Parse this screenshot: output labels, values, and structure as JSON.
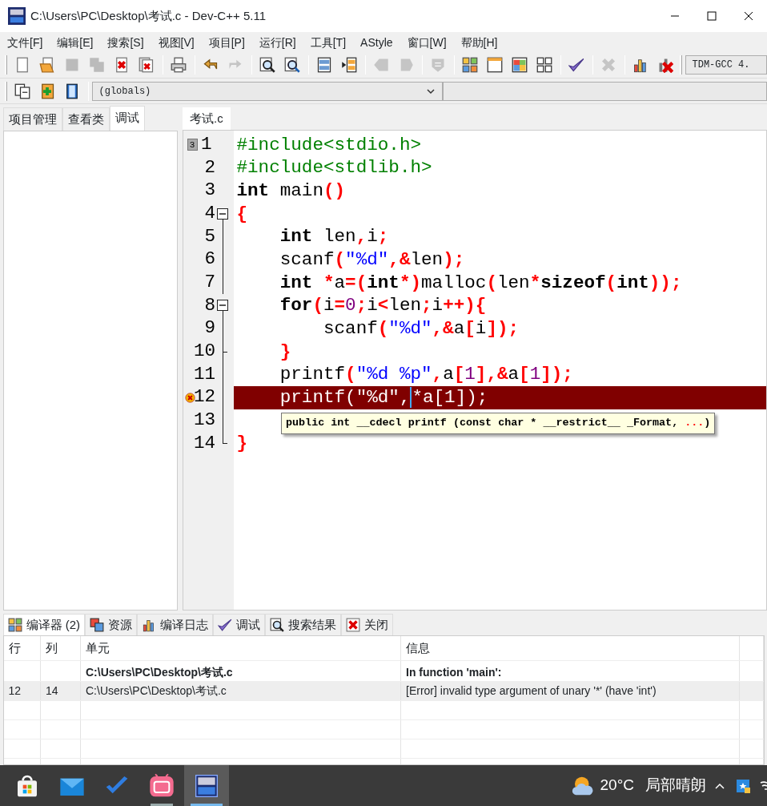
{
  "window": {
    "title": "C:\\Users\\PC\\Desktop\\考试.c - Dev-C++ 5.11"
  },
  "menu": [
    "文件[F]",
    "编辑[E]",
    "搜索[S]",
    "视图[V]",
    "项目[P]",
    "运行[R]",
    "工具[T]",
    "AStyle",
    "窗口[W]",
    "帮助[H]"
  ],
  "toolbar": [
    [
      {
        "kind": "new",
        "disabled": false
      },
      {
        "kind": "open",
        "disabled": false
      },
      {
        "kind": "save",
        "disabled": true
      },
      {
        "kind": "saveall",
        "disabled": true
      },
      {
        "kind": "close",
        "disabled": false
      },
      {
        "kind": "closeall",
        "disabled": false
      }
    ],
    [
      {
        "kind": "print",
        "disabled": false
      }
    ],
    [
      {
        "kind": "undo",
        "disabled": false
      },
      {
        "kind": "redo",
        "disabled": true
      }
    ],
    [
      {
        "kind": "find",
        "disabled": false
      },
      {
        "kind": "replace",
        "disabled": false
      }
    ],
    [
      {
        "kind": "split",
        "disabled": false
      },
      {
        "kind": "panel",
        "disabled": false
      }
    ],
    [
      {
        "kind": "tagleft",
        "disabled": true
      },
      {
        "kind": "tagright",
        "disabled": true
      }
    ],
    [
      {
        "kind": "shield",
        "disabled": true
      }
    ],
    [
      {
        "kind": "squares",
        "disabled": false
      },
      {
        "kind": "window",
        "disabled": false
      },
      {
        "kind": "tiles",
        "disabled": false
      },
      {
        "kind": "grid",
        "disabled": false
      }
    ],
    [
      {
        "kind": "check",
        "disabled": false
      }
    ],
    [
      {
        "kind": "cross",
        "disabled": true
      }
    ],
    [
      {
        "kind": "chart",
        "disabled": false
      },
      {
        "kind": "chartx",
        "disabled": false
      }
    ]
  ],
  "compiler_select": {
    "value": "TDM-GCC 4."
  },
  "toolbar2": [
    {
      "kind": "copy",
      "disabled": false
    },
    {
      "kind": "add",
      "disabled": false
    },
    {
      "kind": "book",
      "disabled": false
    }
  ],
  "scope_select": {
    "value": "(globals)"
  },
  "left_tabs": [
    {
      "label": "项目管理",
      "selected": false
    },
    {
      "label": "查看类",
      "selected": false
    },
    {
      "label": "调试",
      "selected": true
    }
  ],
  "editor_tabs": [
    {
      "label": "考试.c",
      "selected": true
    }
  ],
  "code": [
    {
      "number": "1",
      "bookmark": "3",
      "kind": "plain",
      "error": false,
      "tokens": [
        {
          "kind": "pre",
          "text": "#include<stdio.h>"
        }
      ]
    },
    {
      "number": "2",
      "kind": "plain",
      "error": false,
      "tokens": [
        {
          "kind": "pre",
          "text": "#include<stdlib.h>"
        }
      ]
    },
    {
      "number": "3",
      "kind": "plain",
      "error": false,
      "tokens": [
        {
          "kind": "kw",
          "text": "int"
        },
        {
          "kind": "id",
          "text": " main"
        },
        {
          "kind": "op",
          "text": "()"
        }
      ]
    },
    {
      "number": "4",
      "kind": "open",
      "error": false,
      "tokens": [
        {
          "kind": "op",
          "text": "{"
        }
      ]
    },
    {
      "number": "5",
      "kind": "inner",
      "error": false,
      "tokens": [
        {
          "kind": "kw",
          "text": "    int"
        },
        {
          "kind": "id",
          "text": " len"
        },
        {
          "kind": "op",
          "text": ","
        },
        {
          "kind": "id",
          "text": "i"
        },
        {
          "kind": "op",
          "text": ";"
        }
      ]
    },
    {
      "number": "6",
      "kind": "inner",
      "error": false,
      "tokens": [
        {
          "kind": "id",
          "text": "    scanf"
        },
        {
          "kind": "op",
          "text": "("
        },
        {
          "kind": "str",
          "text": "\"%d\""
        },
        {
          "kind": "op",
          "text": ",&"
        },
        {
          "kind": "id",
          "text": "len"
        },
        {
          "kind": "op",
          "text": ");"
        }
      ]
    },
    {
      "number": "7",
      "kind": "inner",
      "error": false,
      "tokens": [
        {
          "kind": "kw",
          "text": "    int "
        },
        {
          "kind": "op",
          "text": "*"
        },
        {
          "kind": "id",
          "text": "a"
        },
        {
          "kind": "op",
          "text": "=("
        },
        {
          "kind": "kw",
          "text": "int"
        },
        {
          "kind": "op",
          "text": "*)"
        },
        {
          "kind": "id",
          "text": "malloc"
        },
        {
          "kind": "op",
          "text": "("
        },
        {
          "kind": "id",
          "text": "len"
        },
        {
          "kind": "op",
          "text": "*"
        },
        {
          "kind": "kw",
          "text": "sizeof"
        },
        {
          "kind": "op",
          "text": "("
        },
        {
          "kind": "kw",
          "text": "int"
        },
        {
          "kind": "op",
          "text": "));"
        }
      ]
    },
    {
      "number": "8",
      "kind": "open",
      "error": false,
      "tokens": [
        {
          "kind": "kw",
          "text": "    for"
        },
        {
          "kind": "op",
          "text": "("
        },
        {
          "kind": "id",
          "text": "i"
        },
        {
          "kind": "op",
          "text": "="
        },
        {
          "kind": "num",
          "text": "0"
        },
        {
          "kind": "op",
          "text": ";"
        },
        {
          "kind": "id",
          "text": "i"
        },
        {
          "kind": "op",
          "text": "<"
        },
        {
          "kind": "id",
          "text": "len"
        },
        {
          "kind": "op",
          "text": ";"
        },
        {
          "kind": "id",
          "text": "i"
        },
        {
          "kind": "op",
          "text": "++){"
        }
      ]
    },
    {
      "number": "9",
      "kind": "inner",
      "error": false,
      "tokens": [
        {
          "kind": "id",
          "text": "        scanf"
        },
        {
          "kind": "op",
          "text": "("
        },
        {
          "kind": "str",
          "text": "\"%d\""
        },
        {
          "kind": "op",
          "text": ",&"
        },
        {
          "kind": "id",
          "text": "a"
        },
        {
          "kind": "op",
          "text": "["
        },
        {
          "kind": "id",
          "text": "i"
        },
        {
          "kind": "op",
          "text": "]);"
        }
      ]
    },
    {
      "number": "10",
      "kind": "close",
      "error": false,
      "tokens": [
        {
          "kind": "op",
          "text": "    }"
        }
      ]
    },
    {
      "number": "11",
      "kind": "inner",
      "error": false,
      "tokens": [
        {
          "kind": "id",
          "text": "    printf"
        },
        {
          "kind": "op",
          "text": "("
        },
        {
          "kind": "str",
          "text": "\"%d %p\""
        },
        {
          "kind": "op",
          "text": ","
        },
        {
          "kind": "id",
          "text": "a"
        },
        {
          "kind": "op",
          "text": "["
        },
        {
          "kind": "num",
          "text": "1"
        },
        {
          "kind": "op",
          "text": "],&"
        },
        {
          "kind": "id",
          "text": "a"
        },
        {
          "kind": "op",
          "text": "["
        },
        {
          "kind": "num",
          "text": "1"
        },
        {
          "kind": "op",
          "text": "]);"
        }
      ]
    },
    {
      "number": "12",
      "kind": "inner",
      "error": true,
      "tokens": [
        {
          "kind": "id",
          "text": "    printf(\"%d\","
        },
        {
          "kind": "id",
          "text": "*a[1]);",
          "caret": true
        }
      ]
    },
    {
      "number": "13",
      "kind": "inner",
      "error": false
    },
    {
      "number": "14",
      "kind": "last",
      "error": false,
      "tokens": [
        {
          "kind": "op",
          "text": "}"
        }
      ]
    }
  ],
  "calltip": [
    {
      "kind": "kw",
      "text": "public int __cdecl printf (const char * __restrict__ _Format, "
    },
    {
      "kind": "op",
      "text": "..."
    },
    {
      "kind": "kw",
      "text": ")"
    }
  ],
  "bottom_tabs": [
    {
      "kind": "squares",
      "label": "编译器 (2)",
      "selected": true
    },
    {
      "kind": "copies",
      "label": "资源",
      "selected": false
    },
    {
      "kind": "chart",
      "label": "编译日志",
      "selected": false
    },
    {
      "kind": "check",
      "label": "调试",
      "selected": false
    },
    {
      "kind": "find",
      "label": "搜索结果",
      "selected": false
    },
    {
      "kind": "closex",
      "label": "关闭",
      "selected": false
    }
  ],
  "messages": {
    "columns": [
      "行",
      "列",
      "单元",
      "信息"
    ],
    "rows": [
      {
        "kind": "context",
        "selected": false,
        "unit": "C:\\Users\\PC\\Desktop\\考试.c",
        "message": "In function 'main':"
      },
      {
        "kind": "error",
        "selected": true,
        "line": "12",
        "col": "14",
        "unit": "C:\\Users\\PC\\Desktop\\考试.c",
        "message": "[Error] invalid type argument of unary '*' (have 'int')"
      }
    ]
  },
  "taskbar": {
    "apps": [
      {
        "kind": "store",
        "running": false,
        "active": false
      },
      {
        "kind": "mail",
        "running": false,
        "active": false
      },
      {
        "kind": "todo",
        "running": false,
        "active": false
      },
      {
        "kind": "tv",
        "running": true,
        "active": false
      },
      {
        "kind": "dev",
        "running": true,
        "active": true
      }
    ],
    "temperature": "20°C",
    "weather": "局部晴朗"
  }
}
